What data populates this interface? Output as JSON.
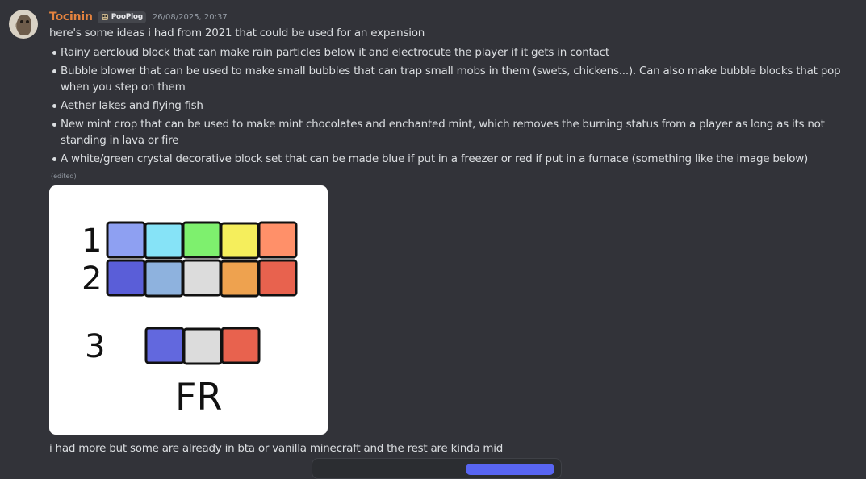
{
  "message": {
    "username": "Tocinin",
    "guild_tag": "PooPlog",
    "timestamp": "26/08/2025, 20:37",
    "intro": "here's some ideas i had from 2021 that could be used for an expansion",
    "ideas": [
      "Rainy aercloud block that can make rain particles below it and electrocute the player if it gets in contact",
      "Bubble blower that can be used to make small bubbles that can trap small mobs in them (swets, chickens...). Can also make bubble blocks that pop when you step on them",
      "Aether lakes and flying fish",
      "New mint crop that can be used to make mint chocolates and enchanted mint, which removes the burning status from a player as long as its not standing in lava or fire",
      "A white/green crystal decorative block set that can be made blue if put in a freezer or red if put in a furnace (something like the image below)"
    ],
    "edited": "(edited)",
    "followup": "i had more but some are already in bta or vanilla minecraft and the rest are kinda mid"
  },
  "attachment": {
    "rows": [
      {
        "label": "1",
        "colors": [
          "#8ea0f2",
          "#86e3f7",
          "#7ef06e",
          "#f5ee5c",
          "#ff9069"
        ]
      },
      {
        "label": "2",
        "colors": [
          "#5a5ed8",
          "#8eb2de",
          "#dcdcdc",
          "#eea24f",
          "#e8624e"
        ]
      },
      {
        "label": "3",
        "colors": [
          "#6268de",
          "#dcdcdc",
          "#e8624e"
        ]
      }
    ],
    "caption": "FR"
  },
  "colors": {
    "background": "#323339",
    "username": "#e4833f",
    "text": "#dbdee1",
    "muted": "#949ba4"
  }
}
